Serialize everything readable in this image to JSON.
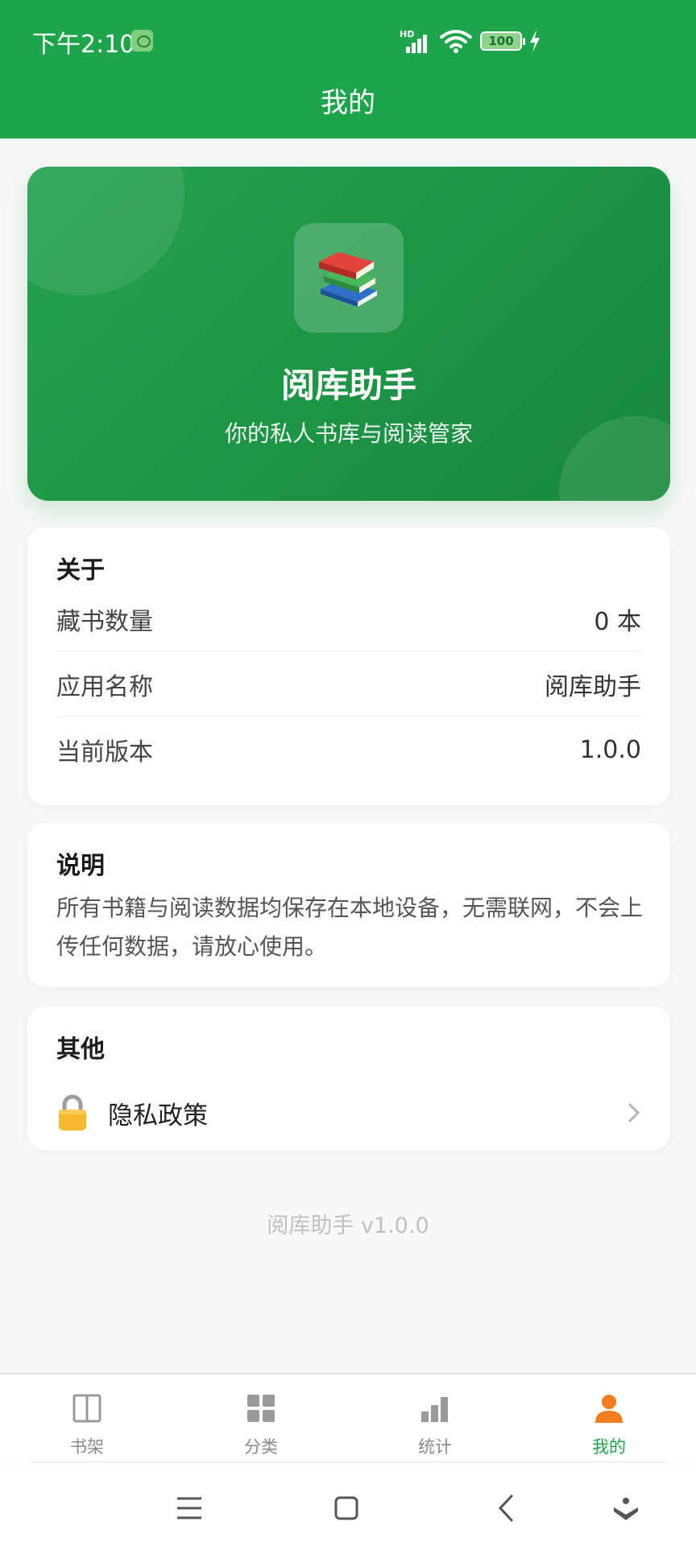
{
  "status_bar": {
    "time": "下午2:10",
    "battery": "100"
  },
  "header": {
    "title": "我的"
  },
  "hero": {
    "app_name": "阅库助手",
    "tagline": "你的私人书库与阅读管家"
  },
  "about": {
    "heading": "关于",
    "rows": [
      {
        "label": "藏书数量",
        "value": "0 本"
      },
      {
        "label": "应用名称",
        "value": "阅库助手"
      },
      {
        "label": "当前版本",
        "value": "1.0.0"
      }
    ]
  },
  "description": {
    "heading": "说明",
    "text": "所有书籍与阅读数据均保存在本地设备，无需联网，不会上传任何数据，请放心使用。"
  },
  "other": {
    "heading": "其他",
    "privacy_label": "隐私政策"
  },
  "footer": {
    "version_text": "阅库助手 v1.0.0"
  },
  "bottom_nav": {
    "items": [
      {
        "label": "书架",
        "icon": "book-icon"
      },
      {
        "label": "分类",
        "icon": "grid-icon"
      },
      {
        "label": "统计",
        "icon": "bar-chart-icon"
      },
      {
        "label": "我的",
        "icon": "person-icon"
      }
    ],
    "active_index": 3
  },
  "colors": {
    "brand_green": "#1ea54c",
    "active_icon_orange": "#f57c1f"
  }
}
